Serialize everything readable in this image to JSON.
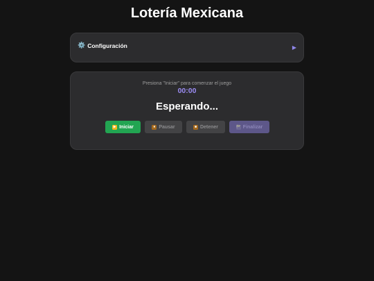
{
  "app": {
    "title": "Lotería Mexicana"
  },
  "config": {
    "icon": "gear-icon",
    "icon_glyph": "⚙️",
    "label": "Configuración",
    "expand_glyph": "▶"
  },
  "game": {
    "instruction": "Presiona \"Iniciar\" para comenzar el juego",
    "timer": "00:00",
    "status": "Esperando..."
  },
  "buttons": {
    "start": {
      "label": "Iniciar",
      "icon": "play-icon",
      "glyph": "▶"
    },
    "pause": {
      "label": "Pausar",
      "icon": "pause-icon",
      "glyph": "⏸"
    },
    "stop": {
      "label": "Detener",
      "icon": "stop-icon",
      "glyph": "■"
    },
    "finish": {
      "label": "Finalizar",
      "icon": "flag-icon",
      "glyph": "🏁"
    }
  },
  "colors": {
    "background": "#141414",
    "panel": "#2c2c2e",
    "accent": "#9b8cf2",
    "start": "#22a552",
    "disabled": "#434345",
    "finish": "#5d5789"
  }
}
